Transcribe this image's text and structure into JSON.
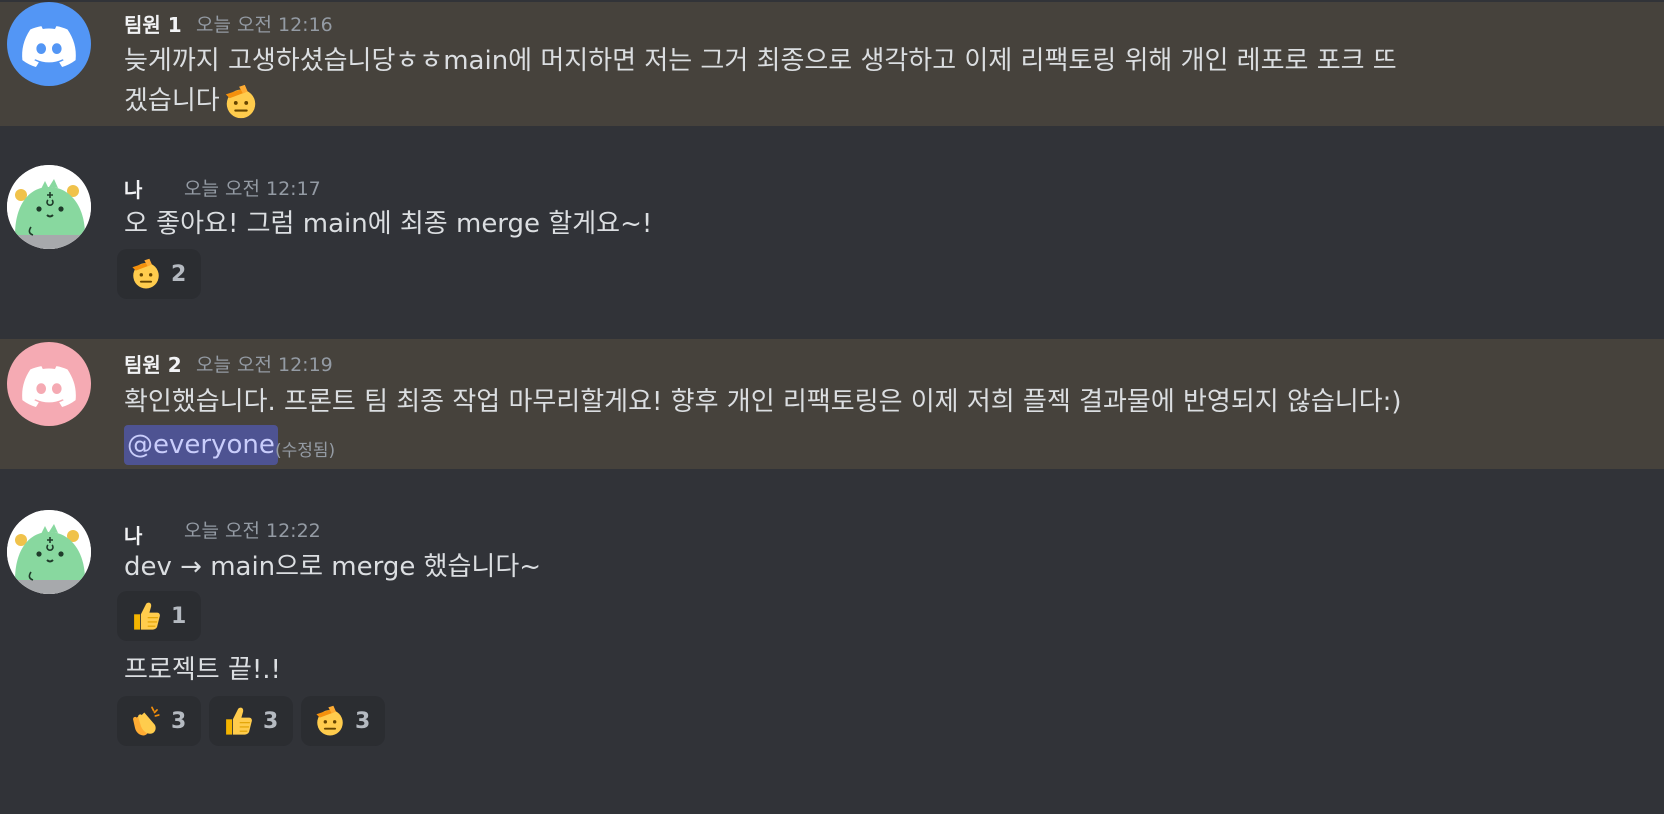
{
  "messages": [
    {
      "author": "팀원 1",
      "timestamp": "오늘 오전 12:16",
      "line1": "늦게까지 고생하셨습니당ㅎㅎmain에 머지하면 저는 그거 최종으로 생각하고 이제 리팩토링 위해 개인 레포로 포크 뜨",
      "line2": "겠습니다",
      "inline_emoji": "saluting-face"
    },
    {
      "author": "나",
      "timestamp": "오늘 오전 12:17",
      "text": "오 좋아요! 그럼 main에 최종 merge 할게요~!",
      "reactions": [
        {
          "emoji": "saluting-face",
          "count": "2"
        }
      ]
    },
    {
      "author": "팀원 2",
      "timestamp": "오늘 오전 12:19",
      "text": "확인했습니다. 프론트 팀 최종 작업 마무리할게요! 향후 개인 리팩토링은 이제 저희 플젝 결과물에 반영되지 않습니다:)",
      "mention": "@everyone",
      "edited": "(수정됨)"
    },
    {
      "author": "나",
      "timestamp": "오늘 오전 12:22",
      "text": "dev → main으로 merge 했습니다~",
      "reactions": [
        {
          "emoji": "thumbs-up",
          "count": "1"
        }
      ],
      "text2": "프로젝트 끝!.!",
      "reactions2": [
        {
          "emoji": "clapping-hands",
          "count": "3"
        },
        {
          "emoji": "thumbs-up",
          "count": "3"
        },
        {
          "emoji": "saluting-face",
          "count": "3"
        }
      ]
    }
  ],
  "colors": {
    "background": "#313338",
    "highlight": "#46423c",
    "mention_bg": "#4e5392",
    "mention_text": "#c9cdfb",
    "discord_blue": "#5396f5",
    "discord_pink": "#f5aab3"
  }
}
